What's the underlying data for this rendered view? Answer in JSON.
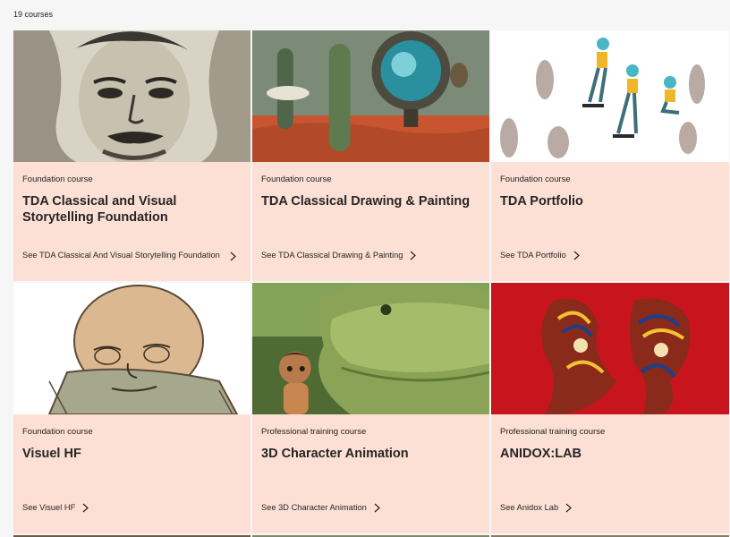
{
  "header": {
    "count": "19 courses"
  },
  "courses": [
    {
      "type": "Foundation course",
      "title": "TDA Classical and Visual Storytelling Foundation",
      "link": "See TDA Classical And Visual Storytelling Foundation"
    },
    {
      "type": "Foundation course",
      "title": "TDA Classical Drawing & Painting",
      "link": "See TDA Classical Drawing & Painting"
    },
    {
      "type": "Foundation course",
      "title": "TDA Portfolio",
      "link": "See TDA Portfolio"
    },
    {
      "type": "Foundation course",
      "title": "Visuel HF",
      "link": "See Visuel HF"
    },
    {
      "type": "Professional training course",
      "title": "3D Character Animation",
      "link": "See 3D Character Animation"
    },
    {
      "type": "Professional training course",
      "title": "ANIDOX:LAB",
      "link": "See Anidox Lab"
    }
  ],
  "colors": {
    "card_bg": "#fde0d5",
    "page_bg": "#f6f6f6"
  }
}
